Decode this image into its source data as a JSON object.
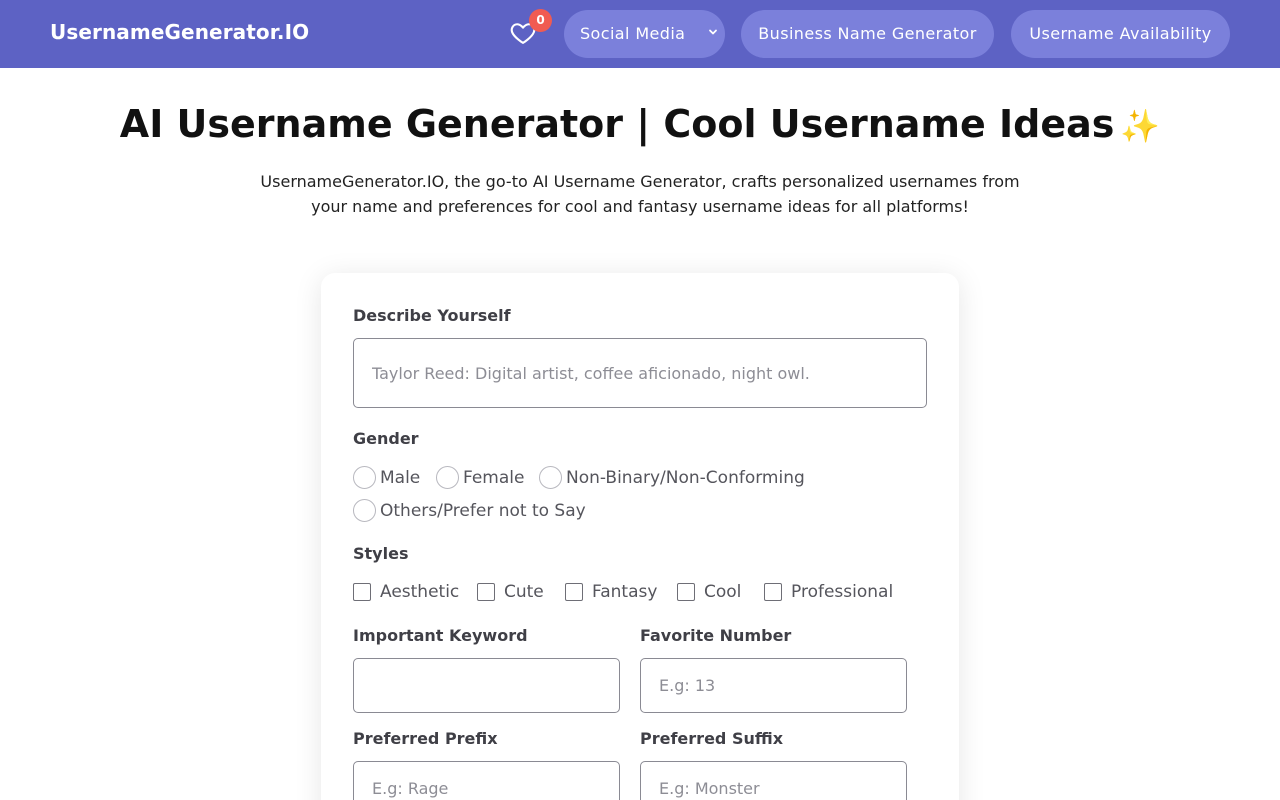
{
  "header": {
    "brand": "UsernameGenerator.IO",
    "favorites_count": "0",
    "nav": {
      "social_media": "Social Media",
      "business_name_generator": "Business Name Generator",
      "username_availability": "Username Availability"
    },
    "colors": {
      "background": "#5d62c4",
      "pill": "#7b80db",
      "badge": "#f05b52"
    }
  },
  "hero": {
    "title": "AI Username Generator | Cool Username Ideas",
    "sparkle": "✨",
    "description": "UsernameGenerator.IO, the go-to AI Username Generator, crafts personalized usernames from your name and preferences for cool and fantasy username ideas for all platforms!"
  },
  "form": {
    "describe": {
      "label": "Describe Yourself",
      "placeholder": "Taylor Reed: Digital artist, coffee aficionado, night owl.",
      "value": ""
    },
    "gender": {
      "label": "Gender",
      "options": [
        "Male",
        "Female",
        "Non-Binary/Non-Conforming",
        "Others/Prefer not to Say"
      ]
    },
    "styles": {
      "label": "Styles",
      "options": [
        "Aesthetic",
        "Cute",
        "Fantasy",
        "Cool",
        "Professional"
      ]
    },
    "keyword": {
      "label": "Important Keyword",
      "placeholder": "",
      "value": ""
    },
    "favorite_number": {
      "label": "Favorite Number",
      "placeholder": "E.g: 13",
      "value": ""
    },
    "prefix": {
      "label": "Preferred Prefix",
      "placeholder": "E.g: Rage",
      "value": ""
    },
    "suffix": {
      "label": "Preferred Suffix",
      "placeholder": "E.g: Monster",
      "value": ""
    }
  }
}
